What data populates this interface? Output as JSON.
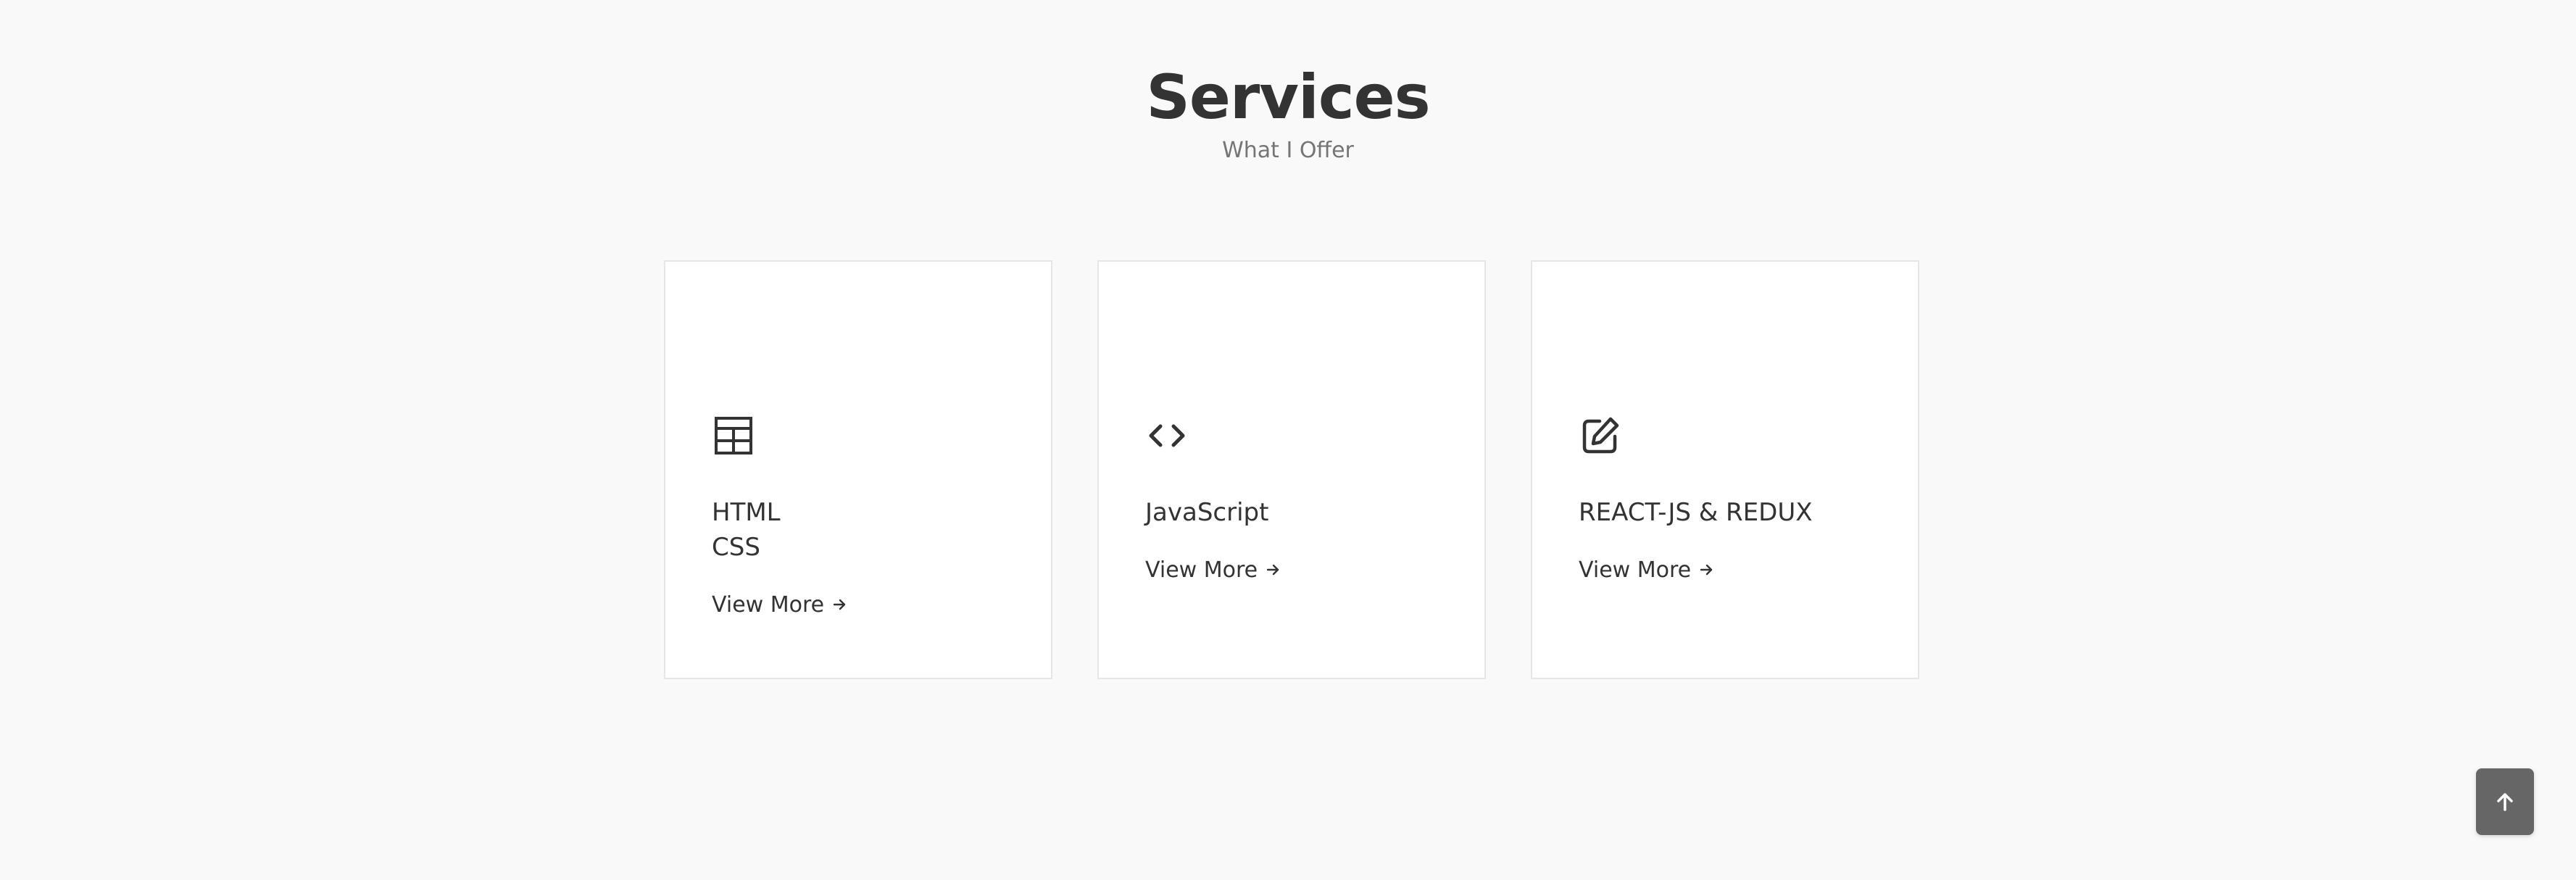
{
  "section": {
    "title": "Services",
    "subtitle": "What I Offer"
  },
  "cards": [
    {
      "title_line1": "HTML",
      "title_line2": "CSS",
      "icon": "table-layout-icon",
      "link_label": "View More",
      "link_icon": "arrow-right-icon"
    },
    {
      "title": "JavaScript",
      "icon": "code-brackets-icon",
      "link_label": "View More",
      "link_icon": "arrow-right-icon"
    },
    {
      "title": "REACT-JS & REDUX",
      "icon": "edit-pencil-icon",
      "link_label": "View More",
      "link_icon": "arrow-right-icon"
    }
  ],
  "scroll_top": {
    "icon": "arrow-up-icon"
  },
  "colors": {
    "background": "#f9f9f9",
    "card_background": "#ffffff",
    "text": "#333333",
    "subtitle": "#757575",
    "scroll_button": "#666666"
  }
}
